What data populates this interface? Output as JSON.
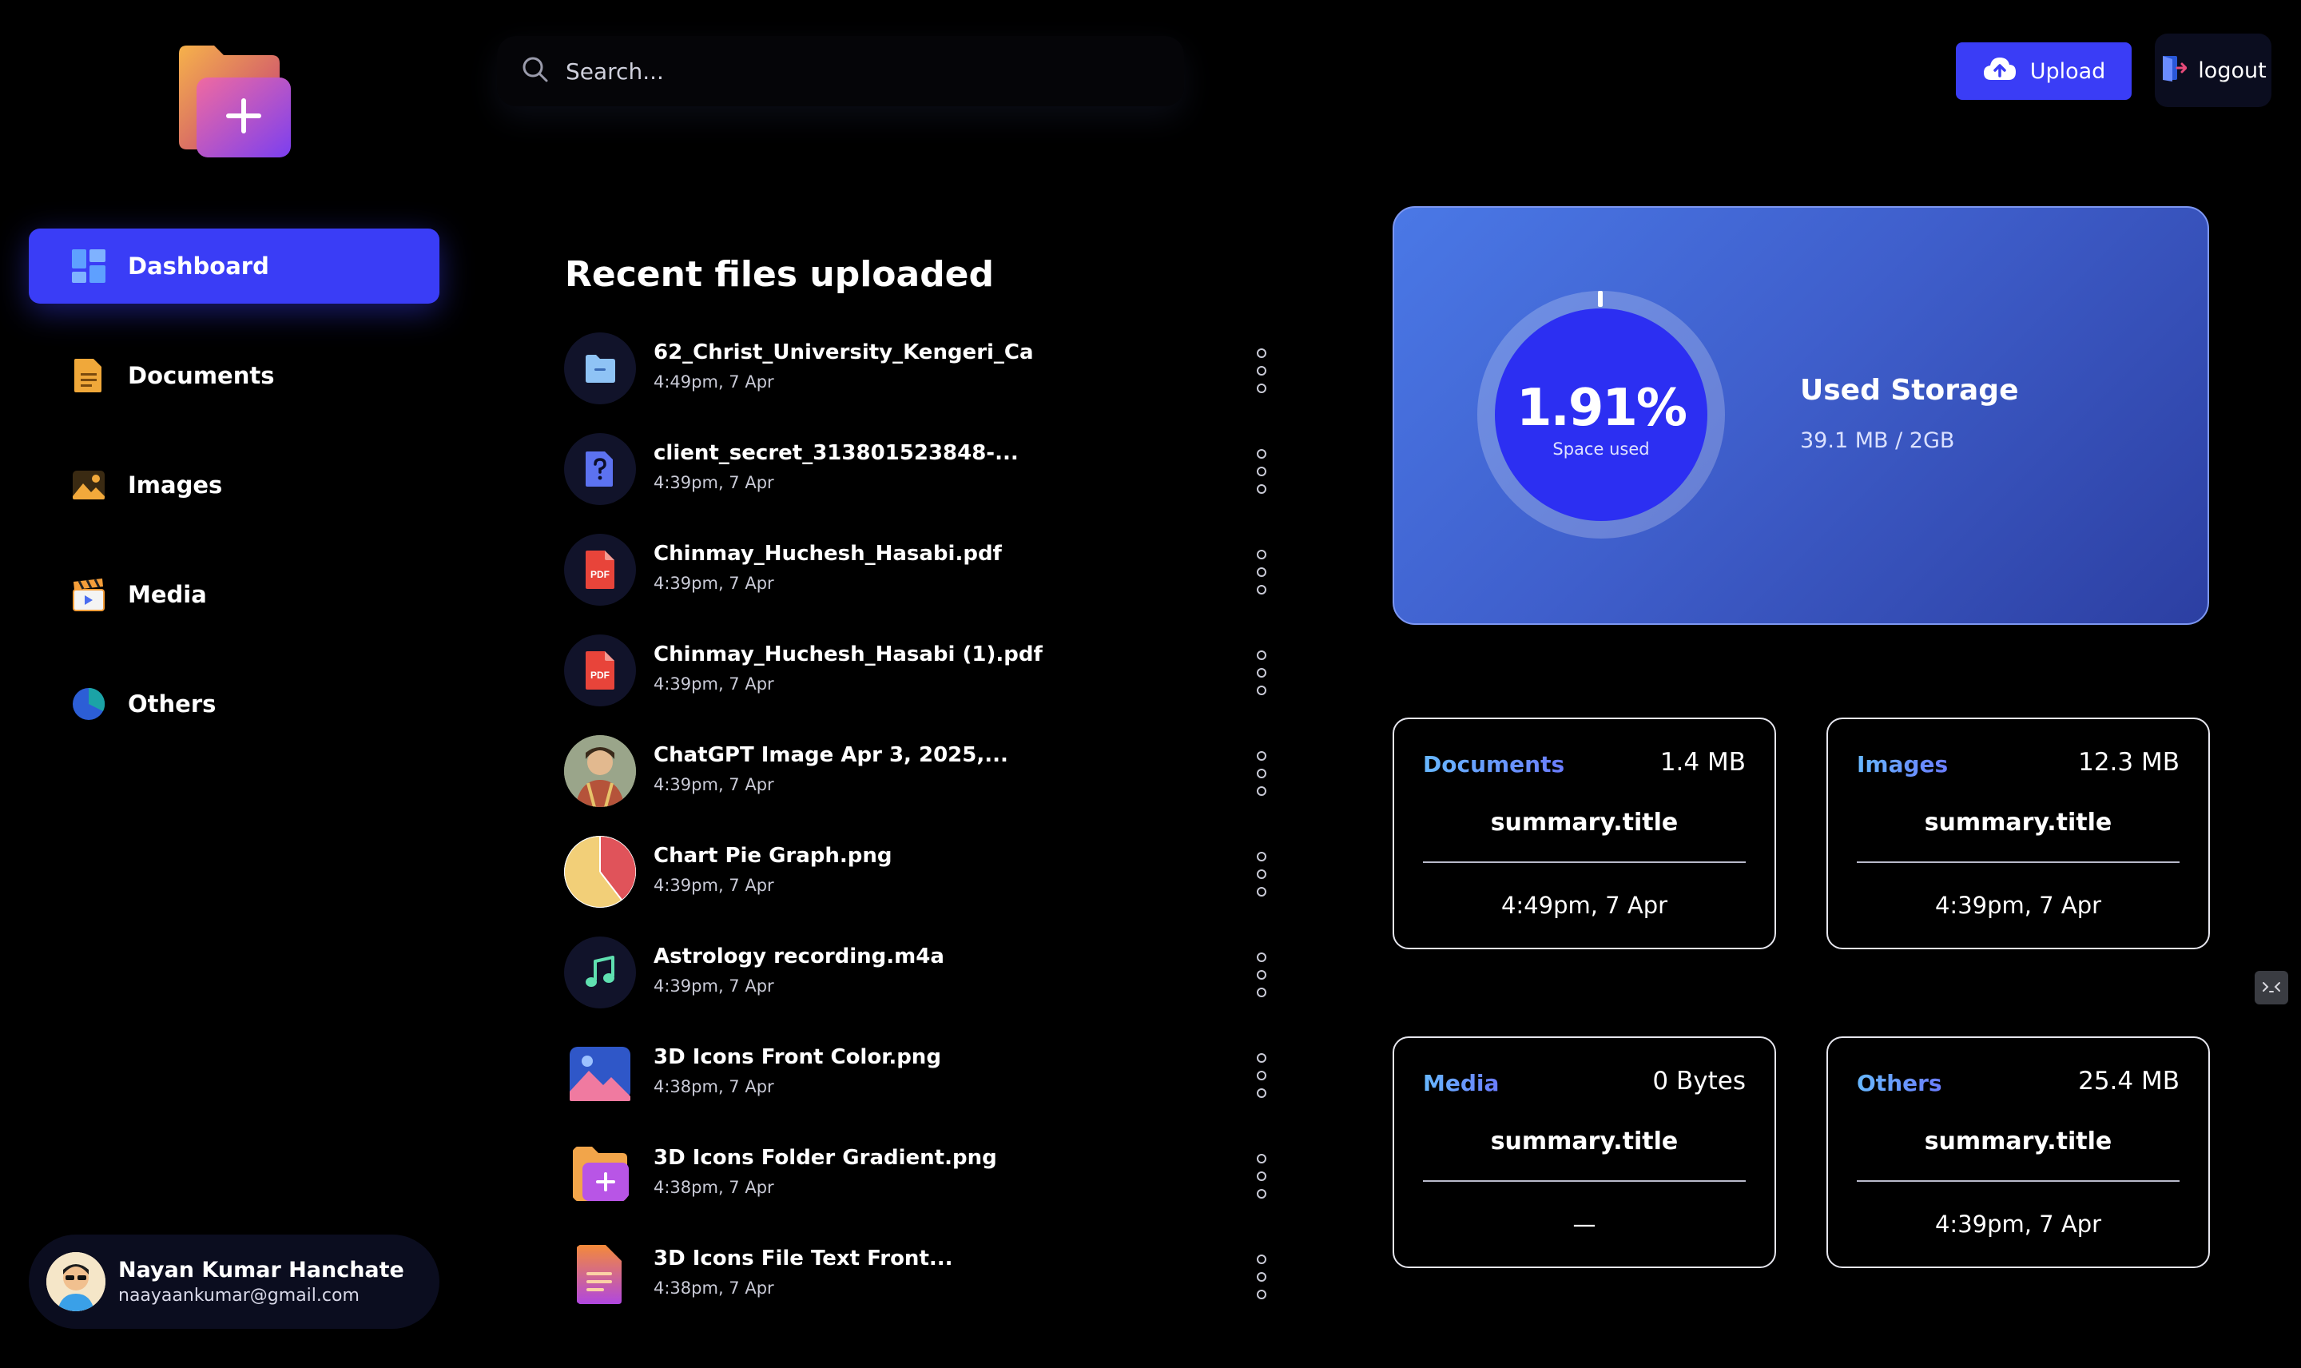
{
  "sidebar": {
    "items": [
      {
        "label": "Dashboard",
        "icon": "dashboard-icon",
        "active": true
      },
      {
        "label": "Documents",
        "icon": "document-icon"
      },
      {
        "label": "Images",
        "icon": "image-icon"
      },
      {
        "label": "Media",
        "icon": "clapperboard-icon"
      },
      {
        "label": "Others",
        "icon": "pie-chart-icon"
      }
    ],
    "user": {
      "name": "Nayan Kumar Hanchate",
      "email": "naayaankumar@gmail.com"
    }
  },
  "header": {
    "search_placeholder": "Search...",
    "upload_label": "Upload",
    "logout_label": "logout"
  },
  "recent": {
    "title": "Recent files uploaded",
    "files": [
      {
        "name": "62_Christ_University_Kengeri_Ca",
        "time": "4:49pm, 7 Apr",
        "icon": "folder-file-icon"
      },
      {
        "name": "client_secret_313801523848-...",
        "time": "4:39pm, 7 Apr",
        "icon": "unknown-file-icon"
      },
      {
        "name": "Chinmay_Huchesh_Hasabi.pdf",
        "time": "4:39pm, 7 Apr",
        "icon": "pdf-icon"
      },
      {
        "name": "Chinmay_Huchesh_Hasabi (1).pdf",
        "time": "4:39pm, 7 Apr",
        "icon": "pdf-icon"
      },
      {
        "name": "ChatGPT Image Apr 3, 2025,...",
        "time": "4:39pm, 7 Apr",
        "icon": "image-thumbnail"
      },
      {
        "name": "Chart Pie Graph.png",
        "time": "4:39pm, 7 Apr",
        "icon": "pie-chart-thumbnail"
      },
      {
        "name": "Astrology recording.m4a",
        "time": "4:39pm, 7 Apr",
        "icon": "music-note-icon"
      },
      {
        "name": "3D Icons Front Color.png",
        "time": "4:38pm, 7 Apr",
        "icon": "picture-thumbnail"
      },
      {
        "name": "3D Icons Folder Gradient.png",
        "time": "4:38pm, 7 Apr",
        "icon": "folder-plus-thumbnail"
      },
      {
        "name": "3D Icons File Text Front...",
        "time": "4:38pm, 7 Apr",
        "icon": "file-text-thumbnail"
      }
    ]
  },
  "storage": {
    "percent_label": "1.91%",
    "percent_value": 1.91,
    "sub_label": "Space used",
    "title": "Used Storage",
    "used": "39.1 MB / 2GB"
  },
  "summaries": [
    {
      "label": "Documents",
      "size": "1.4 MB",
      "title": "summary.title",
      "time": "4:49pm, 7 Apr"
    },
    {
      "label": "Images",
      "size": "12.3 MB",
      "title": "summary.title",
      "time": "4:39pm, 7 Apr"
    },
    {
      "label": "Media",
      "size": "0 Bytes",
      "title": "summary.title",
      "time": "—"
    },
    {
      "label": "Others",
      "size": "25.4 MB",
      "title": "summary.title",
      "time": "4:39pm, 7 Apr"
    }
  ],
  "colors": {
    "accent": "#3a3df6",
    "background": "#000000",
    "card_blue": "#3f5fcc"
  }
}
